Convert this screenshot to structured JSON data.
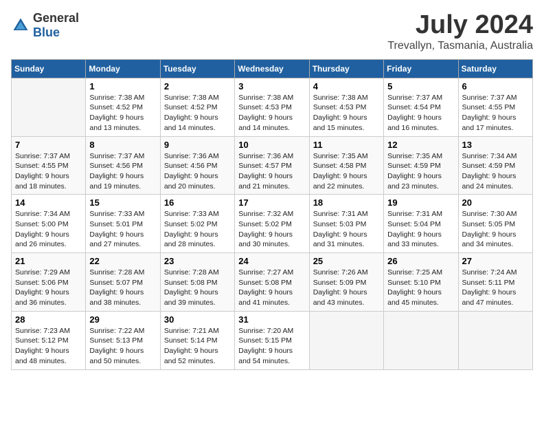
{
  "logo": {
    "general": "General",
    "blue": "Blue"
  },
  "title": {
    "month_year": "July 2024",
    "location": "Trevallyn, Tasmania, Australia"
  },
  "days_of_week": [
    "Sunday",
    "Monday",
    "Tuesday",
    "Wednesday",
    "Thursday",
    "Friday",
    "Saturday"
  ],
  "weeks": [
    [
      {
        "day": "",
        "sunrise": "",
        "sunset": "",
        "daylight": ""
      },
      {
        "day": "1",
        "sunrise": "Sunrise: 7:38 AM",
        "sunset": "Sunset: 4:52 PM",
        "daylight": "Daylight: 9 hours and 13 minutes."
      },
      {
        "day": "2",
        "sunrise": "Sunrise: 7:38 AM",
        "sunset": "Sunset: 4:52 PM",
        "daylight": "Daylight: 9 hours and 14 minutes."
      },
      {
        "day": "3",
        "sunrise": "Sunrise: 7:38 AM",
        "sunset": "Sunset: 4:53 PM",
        "daylight": "Daylight: 9 hours and 14 minutes."
      },
      {
        "day": "4",
        "sunrise": "Sunrise: 7:38 AM",
        "sunset": "Sunset: 4:53 PM",
        "daylight": "Daylight: 9 hours and 15 minutes."
      },
      {
        "day": "5",
        "sunrise": "Sunrise: 7:37 AM",
        "sunset": "Sunset: 4:54 PM",
        "daylight": "Daylight: 9 hours and 16 minutes."
      },
      {
        "day": "6",
        "sunrise": "Sunrise: 7:37 AM",
        "sunset": "Sunset: 4:55 PM",
        "daylight": "Daylight: 9 hours and 17 minutes."
      }
    ],
    [
      {
        "day": "7",
        "sunrise": "Sunrise: 7:37 AM",
        "sunset": "Sunset: 4:55 PM",
        "daylight": "Daylight: 9 hours and 18 minutes."
      },
      {
        "day": "8",
        "sunrise": "Sunrise: 7:37 AM",
        "sunset": "Sunset: 4:56 PM",
        "daylight": "Daylight: 9 hours and 19 minutes."
      },
      {
        "day": "9",
        "sunrise": "Sunrise: 7:36 AM",
        "sunset": "Sunset: 4:56 PM",
        "daylight": "Daylight: 9 hours and 20 minutes."
      },
      {
        "day": "10",
        "sunrise": "Sunrise: 7:36 AM",
        "sunset": "Sunset: 4:57 PM",
        "daylight": "Daylight: 9 hours and 21 minutes."
      },
      {
        "day": "11",
        "sunrise": "Sunrise: 7:35 AM",
        "sunset": "Sunset: 4:58 PM",
        "daylight": "Daylight: 9 hours and 22 minutes."
      },
      {
        "day": "12",
        "sunrise": "Sunrise: 7:35 AM",
        "sunset": "Sunset: 4:59 PM",
        "daylight": "Daylight: 9 hours and 23 minutes."
      },
      {
        "day": "13",
        "sunrise": "Sunrise: 7:34 AM",
        "sunset": "Sunset: 4:59 PM",
        "daylight": "Daylight: 9 hours and 24 minutes."
      }
    ],
    [
      {
        "day": "14",
        "sunrise": "Sunrise: 7:34 AM",
        "sunset": "Sunset: 5:00 PM",
        "daylight": "Daylight: 9 hours and 26 minutes."
      },
      {
        "day": "15",
        "sunrise": "Sunrise: 7:33 AM",
        "sunset": "Sunset: 5:01 PM",
        "daylight": "Daylight: 9 hours and 27 minutes."
      },
      {
        "day": "16",
        "sunrise": "Sunrise: 7:33 AM",
        "sunset": "Sunset: 5:02 PM",
        "daylight": "Daylight: 9 hours and 28 minutes."
      },
      {
        "day": "17",
        "sunrise": "Sunrise: 7:32 AM",
        "sunset": "Sunset: 5:02 PM",
        "daylight": "Daylight: 9 hours and 30 minutes."
      },
      {
        "day": "18",
        "sunrise": "Sunrise: 7:31 AM",
        "sunset": "Sunset: 5:03 PM",
        "daylight": "Daylight: 9 hours and 31 minutes."
      },
      {
        "day": "19",
        "sunrise": "Sunrise: 7:31 AM",
        "sunset": "Sunset: 5:04 PM",
        "daylight": "Daylight: 9 hours and 33 minutes."
      },
      {
        "day": "20",
        "sunrise": "Sunrise: 7:30 AM",
        "sunset": "Sunset: 5:05 PM",
        "daylight": "Daylight: 9 hours and 34 minutes."
      }
    ],
    [
      {
        "day": "21",
        "sunrise": "Sunrise: 7:29 AM",
        "sunset": "Sunset: 5:06 PM",
        "daylight": "Daylight: 9 hours and 36 minutes."
      },
      {
        "day": "22",
        "sunrise": "Sunrise: 7:28 AM",
        "sunset": "Sunset: 5:07 PM",
        "daylight": "Daylight: 9 hours and 38 minutes."
      },
      {
        "day": "23",
        "sunrise": "Sunrise: 7:28 AM",
        "sunset": "Sunset: 5:08 PM",
        "daylight": "Daylight: 9 hours and 39 minutes."
      },
      {
        "day": "24",
        "sunrise": "Sunrise: 7:27 AM",
        "sunset": "Sunset: 5:08 PM",
        "daylight": "Daylight: 9 hours and 41 minutes."
      },
      {
        "day": "25",
        "sunrise": "Sunrise: 7:26 AM",
        "sunset": "Sunset: 5:09 PM",
        "daylight": "Daylight: 9 hours and 43 minutes."
      },
      {
        "day": "26",
        "sunrise": "Sunrise: 7:25 AM",
        "sunset": "Sunset: 5:10 PM",
        "daylight": "Daylight: 9 hours and 45 minutes."
      },
      {
        "day": "27",
        "sunrise": "Sunrise: 7:24 AM",
        "sunset": "Sunset: 5:11 PM",
        "daylight": "Daylight: 9 hours and 47 minutes."
      }
    ],
    [
      {
        "day": "28",
        "sunrise": "Sunrise: 7:23 AM",
        "sunset": "Sunset: 5:12 PM",
        "daylight": "Daylight: 9 hours and 48 minutes."
      },
      {
        "day": "29",
        "sunrise": "Sunrise: 7:22 AM",
        "sunset": "Sunset: 5:13 PM",
        "daylight": "Daylight: 9 hours and 50 minutes."
      },
      {
        "day": "30",
        "sunrise": "Sunrise: 7:21 AM",
        "sunset": "Sunset: 5:14 PM",
        "daylight": "Daylight: 9 hours and 52 minutes."
      },
      {
        "day": "31",
        "sunrise": "Sunrise: 7:20 AM",
        "sunset": "Sunset: 5:15 PM",
        "daylight": "Daylight: 9 hours and 54 minutes."
      },
      {
        "day": "",
        "sunrise": "",
        "sunset": "",
        "daylight": ""
      },
      {
        "day": "",
        "sunrise": "",
        "sunset": "",
        "daylight": ""
      },
      {
        "day": "",
        "sunrise": "",
        "sunset": "",
        "daylight": ""
      }
    ]
  ]
}
